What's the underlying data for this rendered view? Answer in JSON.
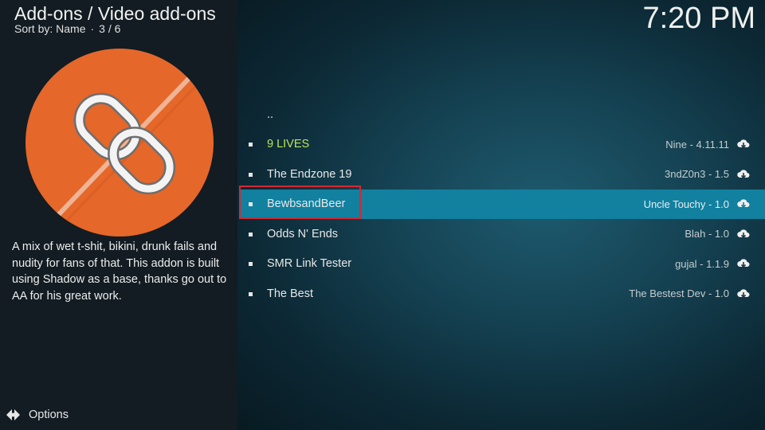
{
  "header": {
    "breadcrumb": "Add-ons / Video add-ons",
    "sort_label": "Sort by: Name",
    "position": "3 / 6"
  },
  "clock": "7:20 PM",
  "selected_addon": {
    "description": "A mix of wet t-shit, bikini, drunk fails and nudity for fans of that. This addon is built using Shadow as a base, thanks go out to AA for his great work.",
    "art_icon": "chain-link-icon",
    "art_color": "#e5672a"
  },
  "options": {
    "label": "Options",
    "icon": "options-arrows-icon"
  },
  "list": {
    "parent": "..",
    "items": [
      {
        "name": "9 LIVES",
        "version": "Nine - 4.11.11",
        "icon": "cloud-download-icon"
      },
      {
        "name": "The Endzone 19",
        "version": "3ndZ0n3 - 1.5",
        "icon": "cloud-download-icon"
      },
      {
        "name": "BewbsandBeer",
        "version": "Uncle Touchy - 1.0",
        "icon": "cloud-download-icon",
        "selected": true
      },
      {
        "name": "Odds N' Ends",
        "version": "Blah - 1.0",
        "icon": "cloud-download-icon"
      },
      {
        "name": "SMR Link Tester",
        "version": "gujal - 1.1.9",
        "icon": "cloud-download-icon"
      },
      {
        "name": "The Best",
        "version": "The Bestest Dev - 1.0",
        "icon": "cloud-download-icon"
      }
    ]
  },
  "colors": {
    "selection": "#12809f",
    "highlight_text": "#b9e55a",
    "focus_border": "#d12a35"
  }
}
